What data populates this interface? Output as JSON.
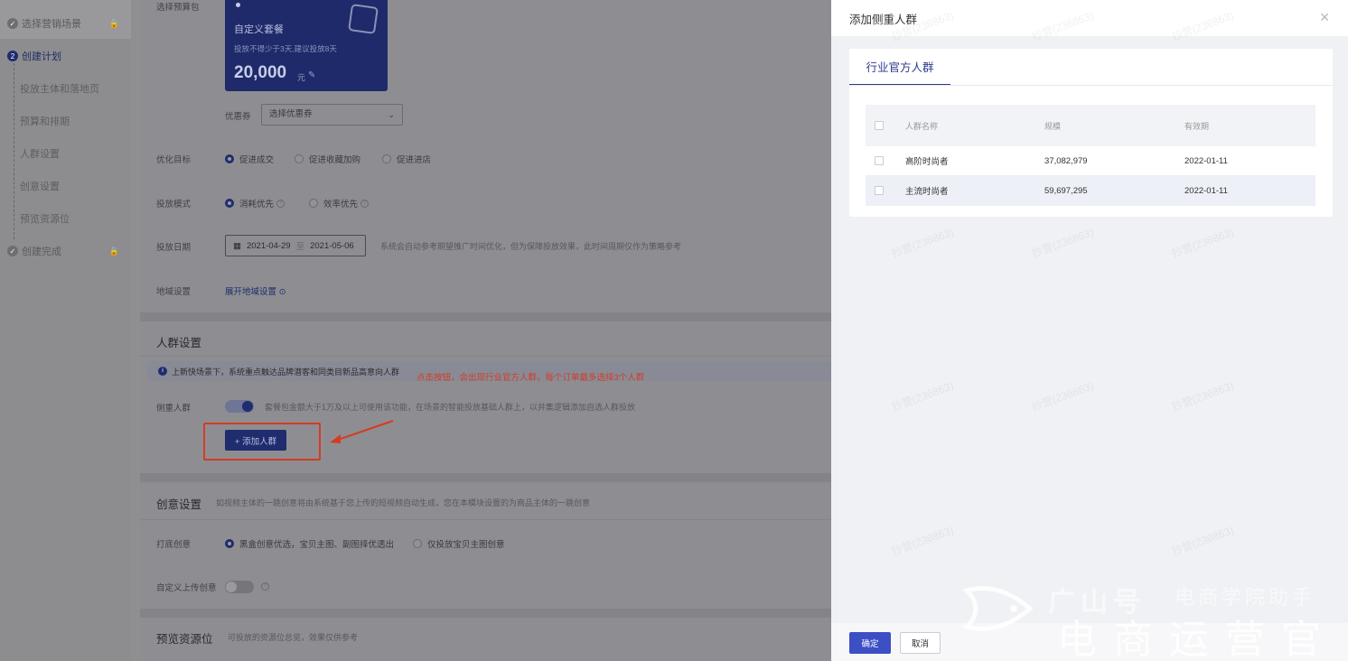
{
  "nav": {
    "step1": "选择营销场景",
    "step2": "创建计划",
    "step2_num": "2",
    "sub": [
      "投放主体和落地页",
      "预算和排期",
      "人群设置",
      "创意设置",
      "预览资源位"
    ],
    "step3": "创建完成"
  },
  "budget": {
    "label": "选择预算包",
    "card_title": "自定义套餐",
    "card_desc": "投放不得少于3天,建议投放8天",
    "amount": "20,000",
    "unit": "元"
  },
  "coupon": {
    "label": "优惠券",
    "placeholder": "选择优惠券"
  },
  "goal": {
    "label": "优化目标",
    "options": [
      "促进成交",
      "促进收藏加购",
      "促进进店"
    ]
  },
  "mode": {
    "label": "投放模式",
    "options": [
      "消耗优先",
      "效率优先"
    ]
  },
  "date": {
    "label": "投放日期",
    "start": "2021-04-29",
    "sep": "至",
    "end": "2021-05-06",
    "note": "系统会自动参考期望推广时间优化，但为保障投放效果，此时间周期仅作为策略参考"
  },
  "region": {
    "label": "地域设置",
    "link": "展开地域设置"
  },
  "audience": {
    "title": "人群设置",
    "info": "上新快场景下，系统重点触达品牌潜客和同类目新品高意向人群",
    "focus_label": "侧重人群",
    "focus_desc": "套餐包金额大于1万及以上可使用该功能，在场景的智能投放基础人群上，以并集逻辑添加自选人群投放",
    "add_button": "+ 添加人群",
    "annotation": "点击按钮，会出现行业官方人群，每个订单最多选择3个人群"
  },
  "creative": {
    "title": "创意设置",
    "desc": "如视频主体的一跳创意将由系统基于您上传的短视频自动生成，您在本模块设置的为商品主体的一跳创意",
    "base_label": "打底创意",
    "base_options": [
      "黑盒创意优选，宝贝主图、副图择优透出",
      "仅投放宝贝主图创意"
    ],
    "custom_label": "自定义上传创意"
  },
  "preview": {
    "title": "预览资源位",
    "desc": "可投放的资源位总览，效果仅供参考"
  },
  "drawer": {
    "title": "添加侧重人群",
    "tab": "行业官方人群",
    "columns": [
      "人群名称",
      "规模",
      "有效期"
    ],
    "rows": [
      {
        "name": "高阶时尚者",
        "size": "37,082,979",
        "expiry": "2022-01-11"
      },
      {
        "name": "主流时尚者",
        "size": "59,697,295",
        "expiry": "2022-01-11"
      }
    ],
    "ok": "确定",
    "cancel": "取消"
  },
  "watermark": "抄营(236863)",
  "logo": {
    "big": "广山号",
    "sub": "电商学院助手",
    "cn": "电商运营官"
  },
  "colors": {
    "primary": "#3c4fc4",
    "annotation": "#d53b24",
    "card": "#1e2a6a"
  }
}
